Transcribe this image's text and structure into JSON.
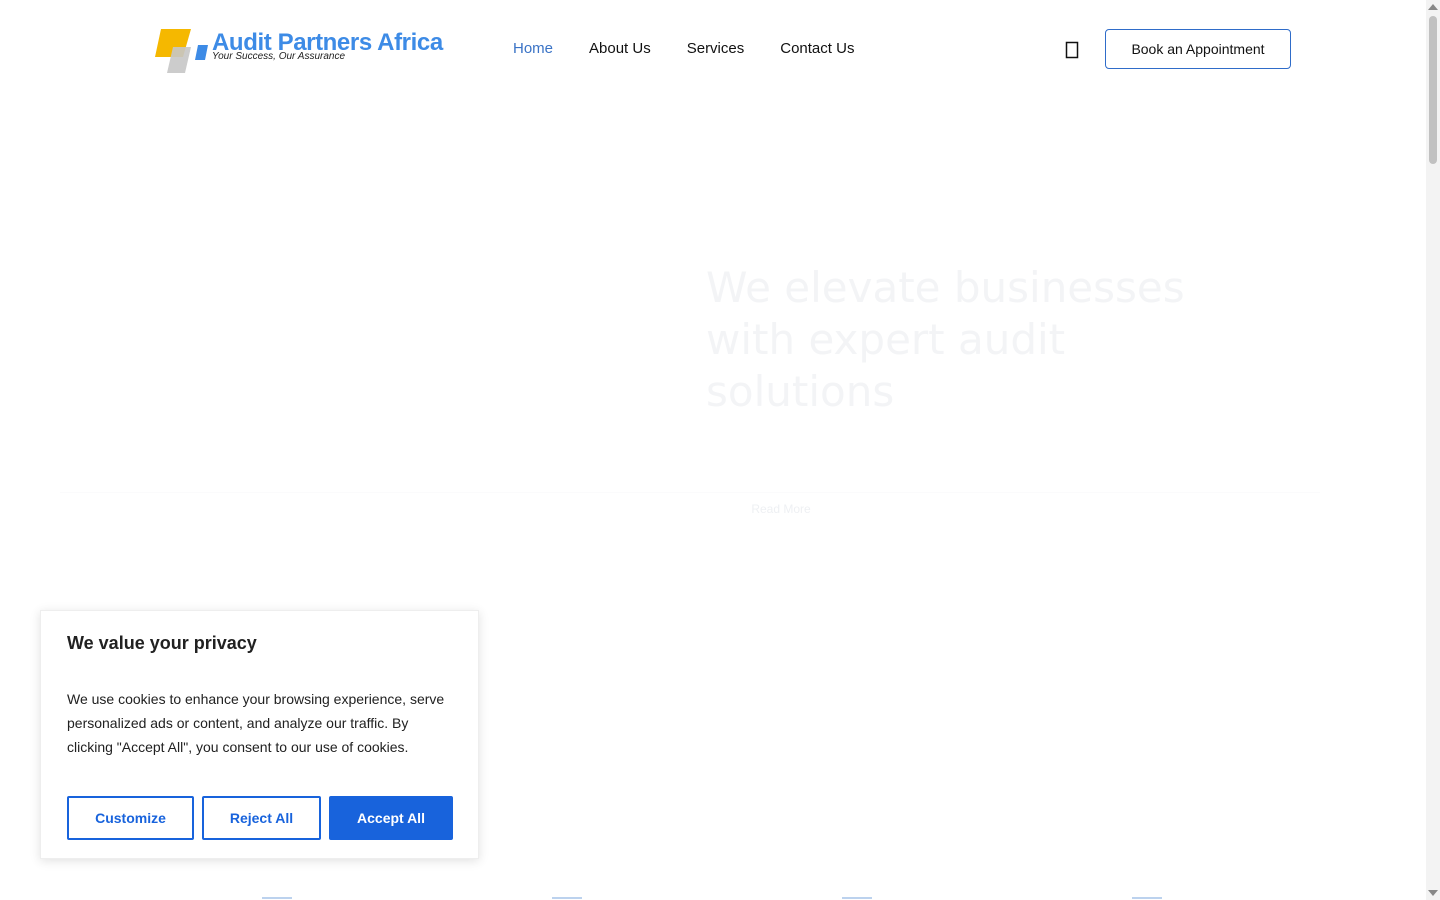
{
  "brand": {
    "name": "Audit Partners Africa",
    "tagline": "Your Success, Our Assurance",
    "colors": {
      "primary": "#3d8be6",
      "accent": "#f5b800",
      "grey": "#c6c6c6"
    }
  },
  "nav": {
    "items": [
      {
        "label": "Home",
        "active": true
      },
      {
        "label": "About Us",
        "active": false
      },
      {
        "label": "Services",
        "active": false
      },
      {
        "label": "Contact Us",
        "active": false
      }
    ],
    "search_icon": "search-icon",
    "book_label": "Book an Appointment"
  },
  "hero": {
    "heading": "We elevate businesses with expert audit solutions",
    "button_label": "Read More"
  },
  "cookie_banner": {
    "title": "We value your privacy",
    "text": "We use cookies to enhance your browsing experience, serve personalized ads or content, and analyze our traffic. By clicking \"Accept All\", you consent to our use of cookies.",
    "customize_label": "Customize",
    "reject_label": "Reject All",
    "accept_label": "Accept All",
    "accent_color": "#1863dc"
  }
}
